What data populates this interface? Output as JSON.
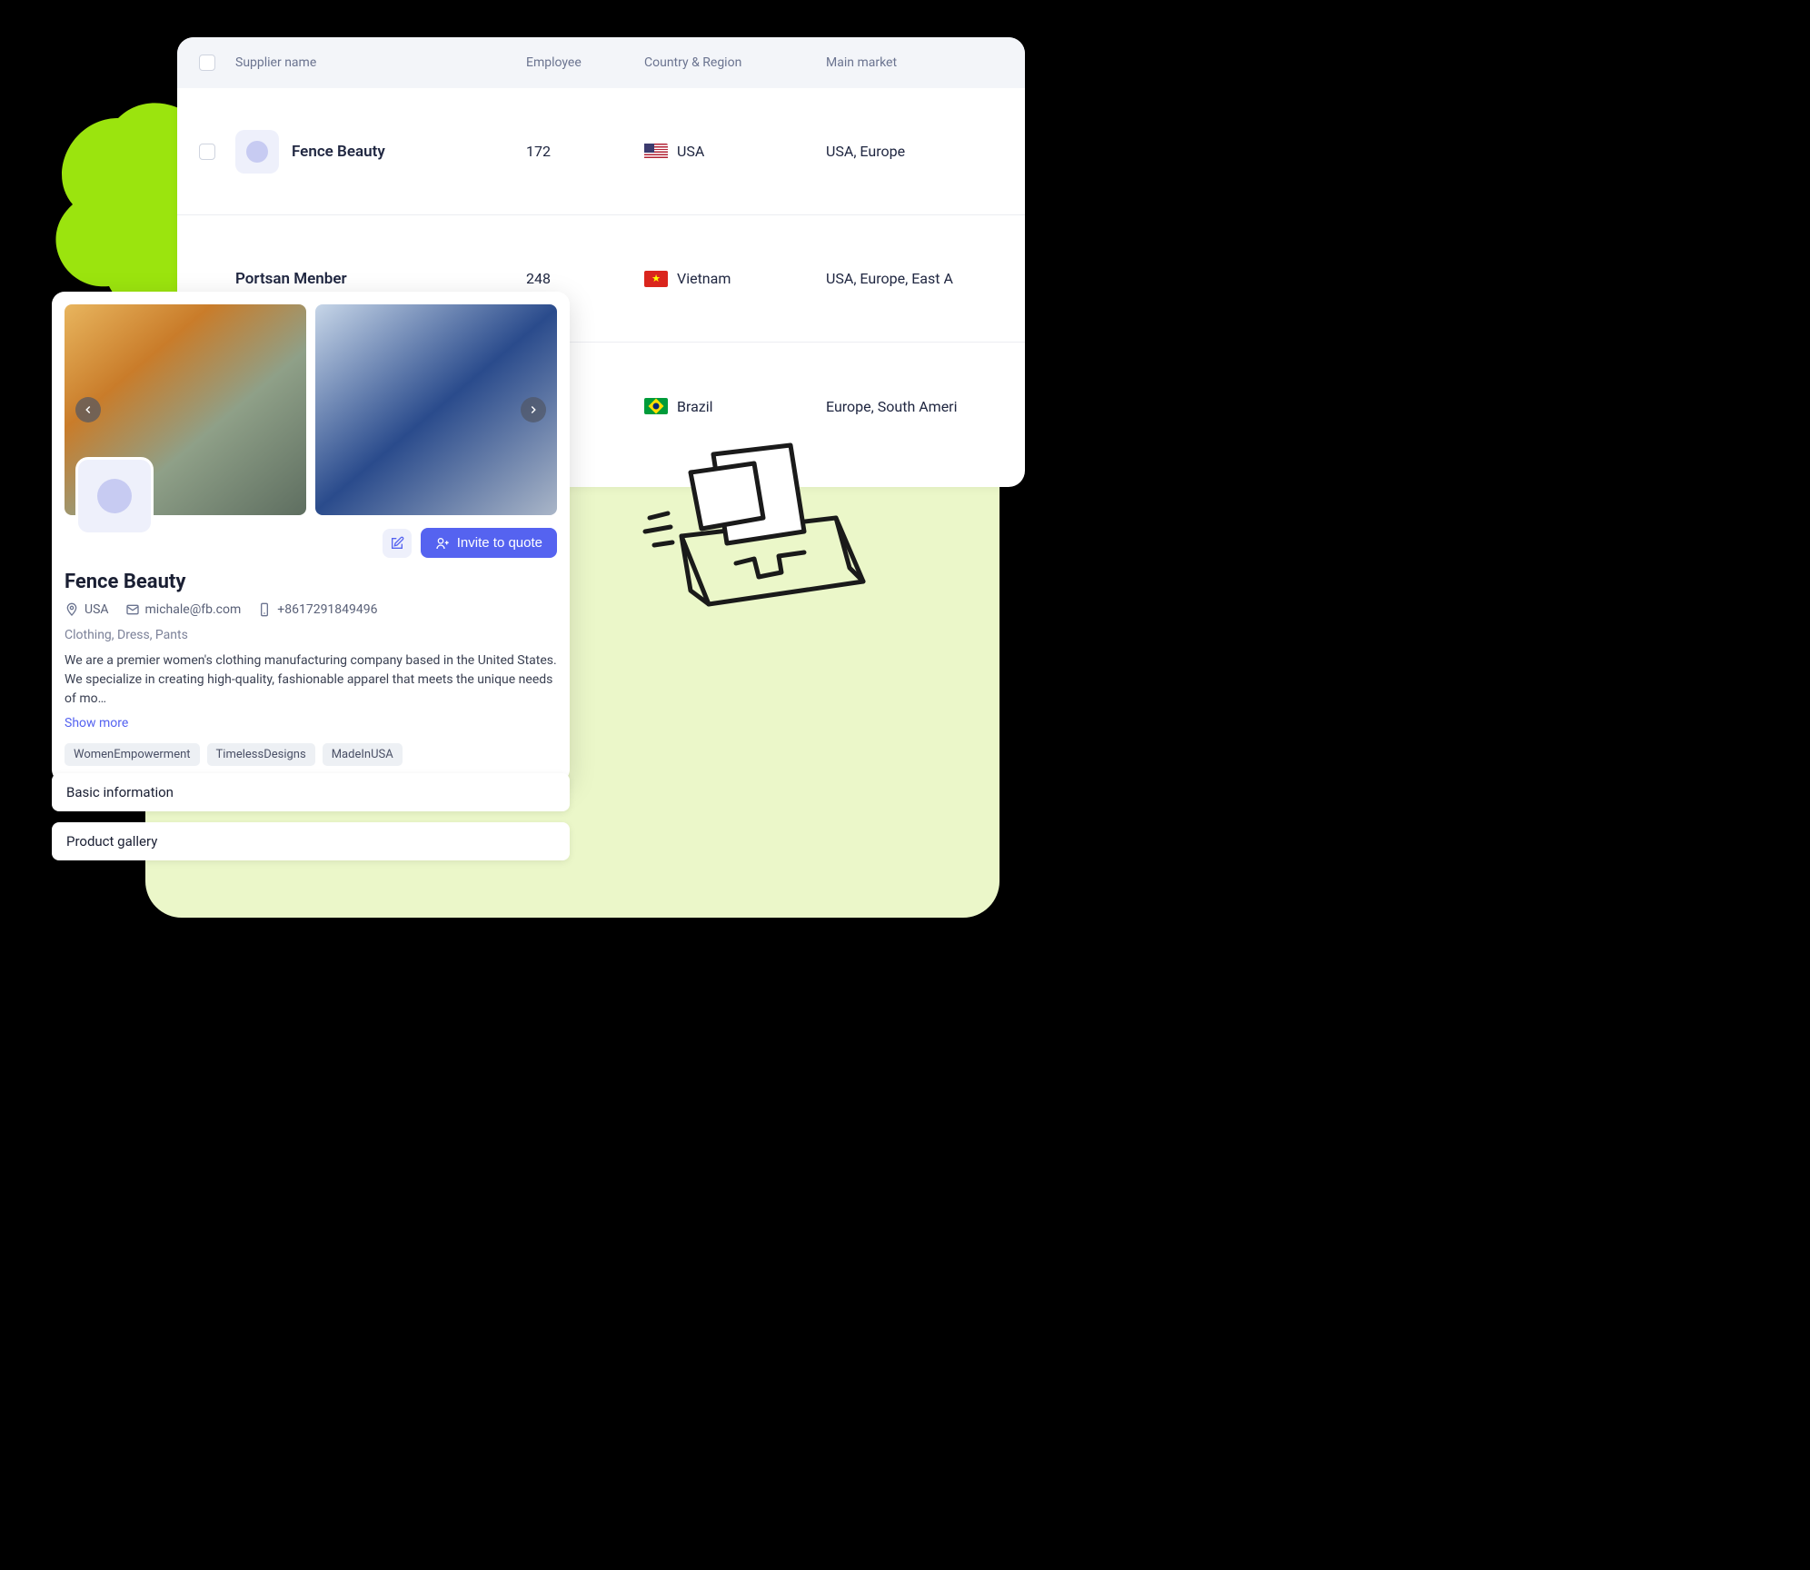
{
  "table": {
    "headers": {
      "supplier": "Supplier name",
      "employee": "Employee",
      "country": "Country & Region",
      "market": "Main market"
    },
    "rows": [
      {
        "name": "Fence Beauty",
        "employee": "172",
        "country": "USA",
        "flag": "us",
        "market": "USA, Europe"
      },
      {
        "name": "Portsan Menber",
        "employee": "248",
        "country": "Vietnam",
        "flag": "vn",
        "market": "USA, Europe, East A"
      },
      {
        "name": "",
        "employee": "",
        "country": "Brazil",
        "flag": "br",
        "market": "Europe, South Ameri"
      }
    ]
  },
  "detail": {
    "title": "Fence Beauty",
    "location": "USA",
    "email": "michale@fb.com",
    "phone": "+8617291849496",
    "categories": "Clothing, Dress, Pants",
    "description": "We are a premier women's clothing manufacturing company based in the United States. We specialize in creating high-quality, fashionable apparel that meets the unique needs of mo…",
    "show_more": "Show more",
    "tags": [
      "WomenEmpowerment",
      "TimelessDesigns",
      "MadeInUSA"
    ],
    "invite_label": "Invite to quote"
  },
  "sections": {
    "basic": "Basic information",
    "gallery": "Product gallery"
  }
}
